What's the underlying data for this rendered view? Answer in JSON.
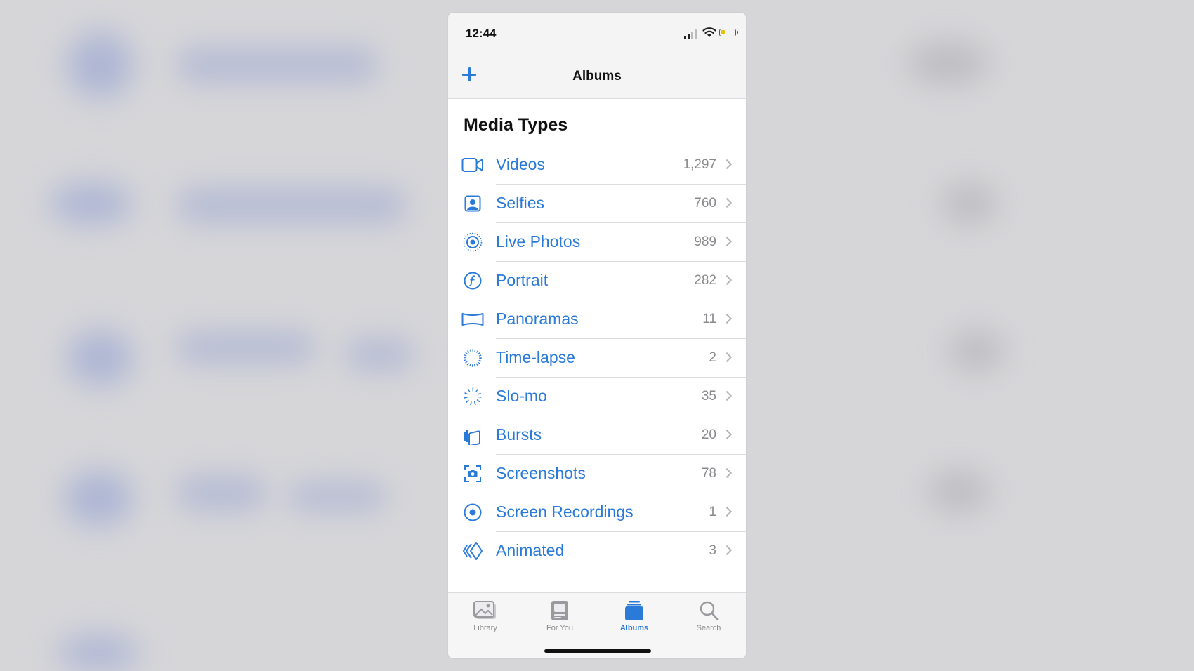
{
  "status_bar": {
    "time": "12:44"
  },
  "nav": {
    "title": "Albums",
    "add_icon": "plus-icon"
  },
  "section": {
    "title": "Media Types"
  },
  "media_types": [
    {
      "label": "Videos",
      "count": "1,297",
      "icon": "video-camera-icon"
    },
    {
      "label": "Selfies",
      "count": "760",
      "icon": "selfie-portrait-icon"
    },
    {
      "label": "Live Photos",
      "count": "989",
      "icon": "live-photo-icon"
    },
    {
      "label": "Portrait",
      "count": "282",
      "icon": "aperture-f-icon"
    },
    {
      "label": "Panoramas",
      "count": "11",
      "icon": "panorama-icon"
    },
    {
      "label": "Time-lapse",
      "count": "2",
      "icon": "timelapse-icon"
    },
    {
      "label": "Slo-mo",
      "count": "35",
      "icon": "slomo-icon"
    },
    {
      "label": "Bursts",
      "count": "20",
      "icon": "bursts-icon"
    },
    {
      "label": "Screenshots",
      "count": "78",
      "icon": "screenshot-icon"
    },
    {
      "label": "Screen Recordings",
      "count": "1",
      "icon": "screen-recording-icon"
    },
    {
      "label": "Animated",
      "count": "3",
      "icon": "animated-icon"
    }
  ],
  "tabs": [
    {
      "label": "Library",
      "icon": "library-icon",
      "active": false
    },
    {
      "label": "For You",
      "icon": "for-you-icon",
      "active": false
    },
    {
      "label": "Albums",
      "icon": "albums-icon",
      "active": true
    },
    {
      "label": "Search",
      "icon": "search-icon",
      "active": false
    }
  ],
  "colors": {
    "accent": "#2a7ad8",
    "count_grey": "#8a8a8e",
    "separator": "#dcdcdf"
  }
}
